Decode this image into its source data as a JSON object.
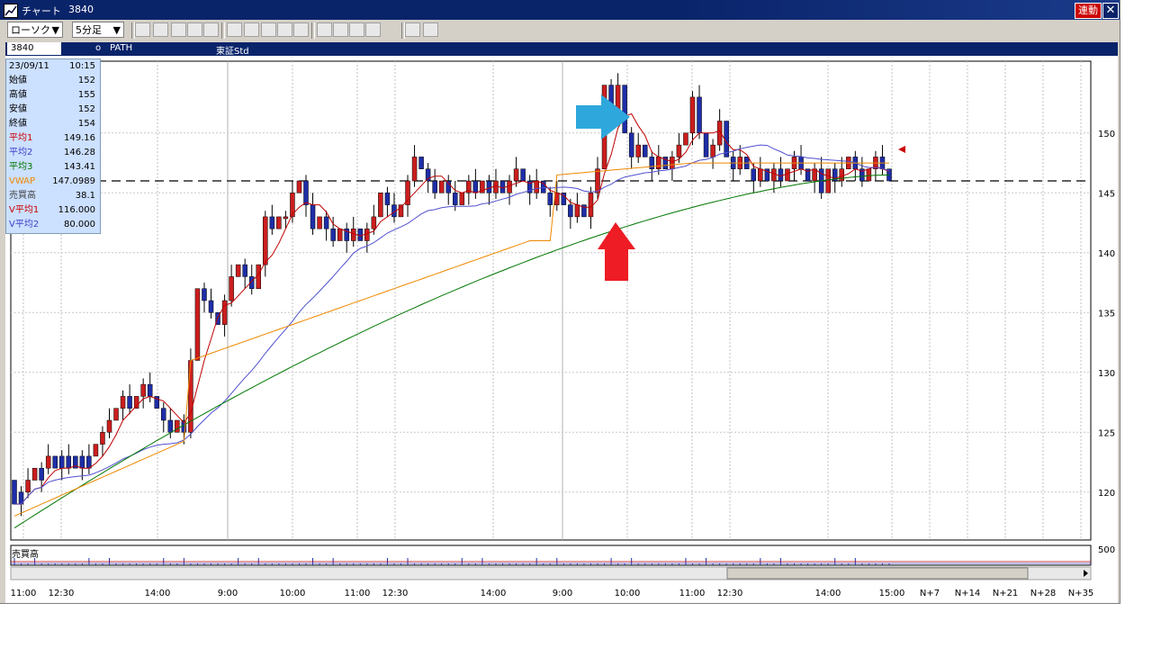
{
  "window": {
    "title": "チャート",
    "code": "3840",
    "link_label": "連動",
    "close_label": "✕"
  },
  "toolbar": {
    "chart_type": "ローソク",
    "chart_type_arrow": "▼",
    "interval": "5分足",
    "interval_arrow": "▼",
    "tools": [
      "new-chart",
      "MA",
      "BB",
      "MRE",
      "PA",
      "line",
      "wave",
      "fib",
      "zoom",
      "bar",
      "pen",
      "cursor",
      "eraser",
      "trash",
      "search",
      "settings"
    ]
  },
  "infobar": {
    "code": "3840",
    "marker": "o",
    "name": "PATH",
    "market": "東証Std"
  },
  "datapanel": {
    "date": "23/09/11",
    "time": "10:15",
    "rows": [
      {
        "k": "始値",
        "v": "152",
        "color": "#000000"
      },
      {
        "k": "高値",
        "v": "155",
        "color": "#000000"
      },
      {
        "k": "安値",
        "v": "152",
        "color": "#000000"
      },
      {
        "k": "終値",
        "v": "154",
        "color": "#000000"
      },
      {
        "k": "平均1",
        "v": "149.16",
        "color": "#cc0000"
      },
      {
        "k": "平均2",
        "v": "146.28",
        "color": "#4040cc"
      },
      {
        "k": "平均3",
        "v": "143.41",
        "color": "#007700"
      },
      {
        "k": "VWAP",
        "v": "147.0989",
        "color": "#ee8800"
      },
      {
        "k": "売買高",
        "v": "38.1",
        "color": "#444444"
      },
      {
        "k": "V平均1",
        "v": "116.000",
        "color": "#cc0000"
      },
      {
        "k": "V平均2",
        "v": "80.000",
        "color": "#4040cc"
      }
    ]
  },
  "volume": {
    "label": "売買高",
    "axis_label": "500"
  },
  "chart_data": {
    "type": "candlestick",
    "y_axis": {
      "min": 116,
      "max": 156,
      "ticks": [
        120,
        125,
        130,
        135,
        140,
        145,
        150
      ]
    },
    "x_tick_labels": [
      "11:00",
      "12:30",
      "14:00",
      "9:00",
      "10:00",
      "11:00",
      "12:30",
      "14:00",
      "9:00",
      "10:00",
      "11:00",
      "12:30",
      "14:00",
      "15:00",
      "N+7",
      "N+14",
      "N+21",
      "N+28",
      "N+35"
    ],
    "reference_line": 146,
    "candles": [
      [
        121,
        119
      ],
      [
        120,
        119
      ],
      [
        120,
        121
      ],
      [
        121,
        122
      ],
      [
        122,
        121
      ],
      [
        122,
        123
      ],
      [
        123,
        122
      ],
      [
        123,
        122
      ],
      [
        123,
        122
      ],
      [
        123,
        122
      ],
      [
        123,
        122
      ],
      [
        123,
        122
      ],
      [
        123,
        124
      ],
      [
        124,
        125
      ],
      [
        125,
        126
      ],
      [
        126,
        127
      ],
      [
        127,
        128
      ],
      [
        128,
        127
      ],
      [
        127,
        128
      ],
      [
        128,
        129
      ],
      [
        129,
        128
      ],
      [
        128,
        127
      ],
      [
        127,
        126
      ],
      [
        126,
        125
      ],
      [
        125,
        126
      ],
      [
        126,
        125
      ],
      [
        125,
        131
      ],
      [
        131,
        137
      ],
      [
        137,
        136
      ],
      [
        136,
        135
      ],
      [
        135,
        134
      ],
      [
        134,
        136
      ],
      [
        136,
        138
      ],
      [
        138,
        139
      ],
      [
        139,
        138
      ],
      [
        138,
        137
      ],
      [
        137,
        139
      ],
      [
        139,
        143
      ],
      [
        143,
        142
      ],
      [
        142,
        143
      ],
      [
        143,
        143
      ],
      [
        143,
        145
      ],
      [
        145,
        146
      ],
      [
        146,
        144
      ],
      [
        144,
        142
      ],
      [
        142,
        143
      ],
      [
        143,
        142
      ],
      [
        142,
        141
      ],
      [
        141,
        142
      ],
      [
        142,
        141
      ],
      [
        141,
        142
      ],
      [
        142,
        141
      ],
      [
        141,
        142
      ],
      [
        142,
        143
      ],
      [
        143,
        145
      ],
      [
        145,
        144
      ],
      [
        144,
        143
      ],
      [
        143,
        144
      ],
      [
        144,
        146
      ],
      [
        146,
        148
      ],
      [
        148,
        147
      ],
      [
        147,
        146
      ],
      [
        146,
        145
      ],
      [
        145,
        146
      ],
      [
        146,
        145
      ],
      [
        145,
        144
      ],
      [
        144,
        145
      ],
      [
        145,
        146
      ],
      [
        146,
        145
      ],
      [
        145,
        146
      ],
      [
        146,
        145
      ],
      [
        145,
        146
      ],
      [
        146,
        145
      ],
      [
        145,
        146
      ],
      [
        146,
        147
      ],
      [
        147,
        146
      ],
      [
        146,
        145
      ],
      [
        145,
        146
      ],
      [
        146,
        145
      ],
      [
        145,
        144
      ],
      [
        144,
        145
      ],
      [
        145,
        144
      ],
      [
        144,
        143
      ],
      [
        143,
        144
      ],
      [
        144,
        143
      ],
      [
        143,
        145
      ],
      [
        145,
        147
      ],
      [
        147,
        154
      ],
      [
        154,
        152
      ],
      [
        152,
        154
      ],
      [
        154,
        150
      ],
      [
        150,
        148
      ],
      [
        148,
        149
      ],
      [
        149,
        148
      ],
      [
        148,
        147
      ],
      [
        147,
        148
      ],
      [
        148,
        147
      ],
      [
        147,
        148
      ],
      [
        148,
        149
      ],
      [
        149,
        150
      ],
      [
        150,
        153
      ],
      [
        153,
        150
      ],
      [
        150,
        148
      ],
      [
        148,
        149
      ],
      [
        149,
        151
      ],
      [
        151,
        148
      ],
      [
        148,
        147
      ],
      [
        147,
        148
      ],
      [
        148,
        147
      ],
      [
        147,
        146
      ],
      [
        146,
        147
      ],
      [
        147,
        146
      ],
      [
        146,
        147
      ],
      [
        147,
        146
      ],
      [
        146,
        147
      ],
      [
        147,
        148
      ],
      [
        148,
        147
      ],
      [
        147,
        146
      ],
      [
        146,
        147
      ],
      [
        147,
        145
      ],
      [
        145,
        147
      ],
      [
        147,
        146
      ],
      [
        146,
        147
      ],
      [
        147,
        148
      ],
      [
        148,
        147
      ],
      [
        147,
        146
      ],
      [
        146,
        147
      ],
      [
        147,
        148
      ],
      [
        148,
        147
      ],
      [
        147,
        146
      ]
    ]
  }
}
